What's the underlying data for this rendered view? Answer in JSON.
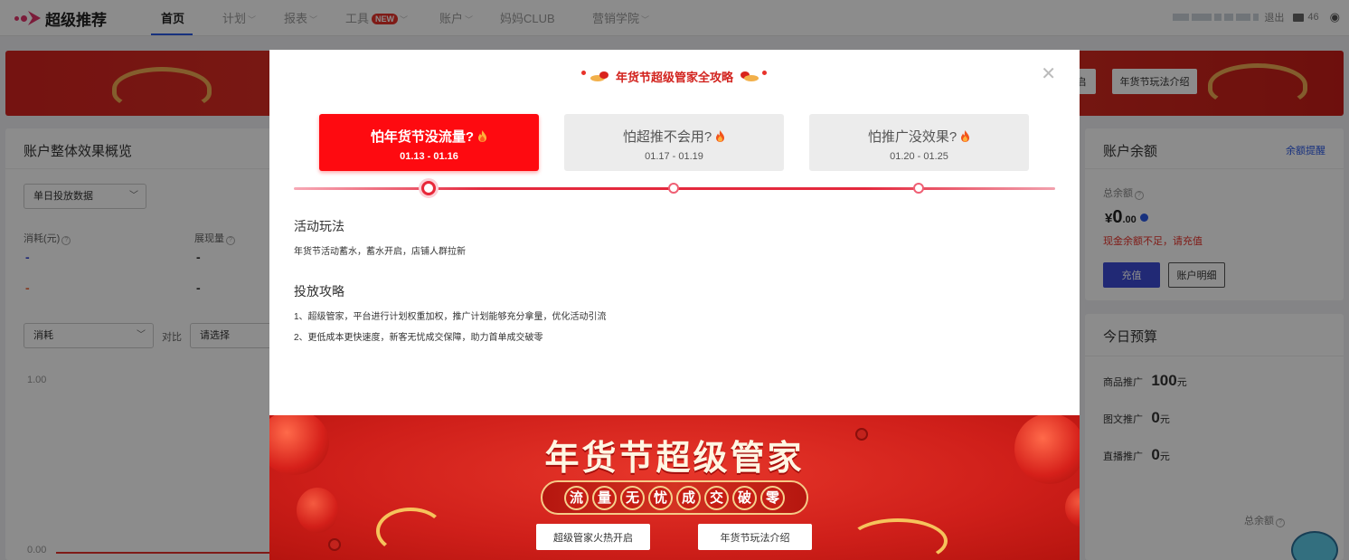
{
  "nav": {
    "logo": "超级推荐",
    "items": [
      {
        "label": "首页",
        "active": true
      },
      {
        "label": "计划",
        "caret": true
      },
      {
        "label": "报表",
        "caret": true
      },
      {
        "label": "工具",
        "caret": true,
        "badge": "NEW"
      },
      {
        "label": "账户",
        "caret": true
      },
      {
        "label": "妈妈CLUB"
      },
      {
        "label": "营销学院",
        "caret": true
      }
    ],
    "logout": "退出",
    "mail_count": "46"
  },
  "background": {
    "banner_buttons": [
      "启",
      "年货节玩法介绍"
    ],
    "overview": {
      "title": "账户整体效果概览",
      "data_select": "单日投放数据",
      "metrics": [
        {
          "label": "消耗(元)",
          "values": [
            "-",
            "-"
          ]
        },
        {
          "label": "展现量",
          "values": [
            "-",
            "-"
          ]
        }
      ],
      "chart_metric": "消耗",
      "compare_label": "对比",
      "compare_placeholder": "请选择",
      "y_ticks": [
        "1.00",
        "0.00"
      ]
    },
    "balance": {
      "title": "账户余额",
      "reminder_link": "余额提醒",
      "total_label": "总余额",
      "currency": "¥",
      "amount_int": "0",
      "amount_dec": ".00",
      "warning": "现金余额不足，请充值",
      "recharge_button": "充值",
      "detail_button": "账户明细"
    },
    "budget": {
      "title": "今日预算",
      "rows": [
        {
          "label": "商品推广",
          "value": "100",
          "unit": "元"
        },
        {
          "label": "图文推广",
          "value": "0",
          "unit": "元"
        },
        {
          "label": "直播推广",
          "value": "0",
          "unit": "元"
        }
      ],
      "total_label": "总余额"
    }
  },
  "modal": {
    "header": "年货节超级管家全攻略",
    "tabs": [
      {
        "title": "怕年货节没流量?",
        "date": "01.13 - 01.16",
        "active": true
      },
      {
        "title": "怕超推不会用?",
        "date": "01.17 - 01.19",
        "active": false
      },
      {
        "title": "怕推广没效果?",
        "date": "01.20 - 01.25",
        "active": false
      }
    ],
    "section1": {
      "title": "活动玩法",
      "lines": [
        "年货节活动蓄水，蓄水开启，店铺人群拉新"
      ]
    },
    "section2": {
      "title": "投放攻略",
      "lines": [
        "1、超级管家，平台进行计划权重加权，推广计划能够充分拿量，优化活动引流",
        "2、更低成本更快速度，新客无忧成交保障，助力首单成交破零"
      ]
    },
    "promo": {
      "title": "年货节超级管家",
      "chars": [
        "流",
        "量",
        "无",
        "忧",
        "成",
        "交",
        "破",
        "零"
      ],
      "button_left": "超级管家火热开启",
      "button_right": "年货节玩法介绍"
    }
  },
  "colors": {
    "primary_red": "#fe0a10",
    "brand_pink": "#e0336b",
    "accent_blue": "#2b59e6",
    "warning_red": "#e8322a"
  }
}
